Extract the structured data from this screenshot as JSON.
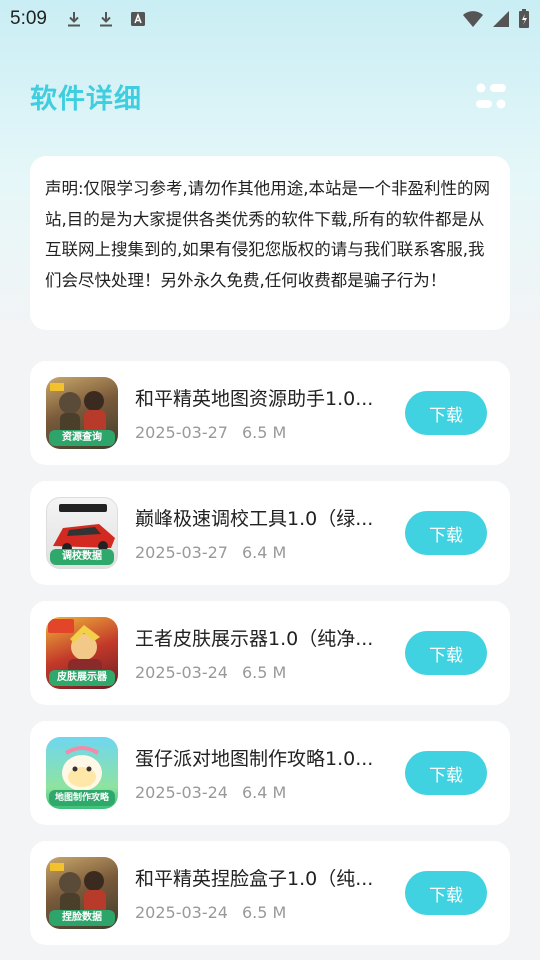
{
  "status_bar": {
    "time": "5:09",
    "left_icons": [
      "download-icon",
      "download-icon",
      "text-a-icon"
    ],
    "right_icons": [
      "wifi-icon",
      "signal-icon",
      "battery-charging-icon"
    ]
  },
  "header": {
    "title": "软件详细",
    "menu_icon": "menu-toggle-icon"
  },
  "notice": {
    "text": "声明:仅限学习参考,请勿作其他用途,本站是一个非盈利性的网站,目的是为大家提供各类优秀的软件下载,所有的软件都是从互联网上搜集到的,如果有侵犯您版权的请与我们联系客服,我们会尽快处理！另外永久免费,任何收费都是骗子行为！"
  },
  "colors": {
    "accent": "#3fcde0",
    "button": "#40d2e0",
    "meta_text": "#999999"
  },
  "apps": [
    {
      "name": "和平精英地图资源助手1.0...",
      "date": "2025-03-27",
      "size": "6.5 M",
      "icon_tag": "资源查询",
      "icon": "pubg-soldiers-icon",
      "button": "下载"
    },
    {
      "name": "巅峰极速调校工具1.0（绿...",
      "date": "2025-03-27",
      "size": "6.4 M",
      "icon_tag": "调校数据",
      "icon": "red-racecar-icon",
      "button": "下载"
    },
    {
      "name": "王者皮肤展示器1.0（纯净...",
      "date": "2025-03-24",
      "size": "6.5 M",
      "icon_tag": "皮肤展示器",
      "icon": "hero-warrior-icon",
      "button": "下载"
    },
    {
      "name": "蛋仔派对地图制作攻略1.0...",
      "date": "2025-03-24",
      "size": "6.4 M",
      "icon_tag": "地图制作攻略",
      "icon": "egg-character-icon",
      "button": "下载"
    },
    {
      "name": "和平精英捏脸盒子1.0（纯...",
      "date": "2025-03-24",
      "size": "6.5 M",
      "icon_tag": "捏脸数据",
      "icon": "pubg-soldiers-icon",
      "button": "下载"
    }
  ]
}
